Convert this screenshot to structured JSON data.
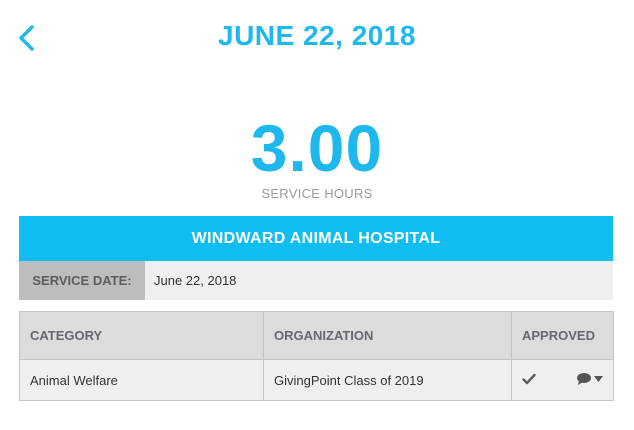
{
  "header": {
    "title": "JUNE 22, 2018",
    "back_icon": "chevron-left-icon"
  },
  "summary": {
    "hours": "3.00",
    "hours_label": "SERVICE HOURS"
  },
  "organization": {
    "name": "WINDWARD ANIMAL HOSPITAL"
  },
  "service_date": {
    "label": "SERVICE DATE:",
    "value": "June 22, 2018"
  },
  "table": {
    "headers": [
      "CATEGORY",
      "ORGANIZATION",
      "APPROVED"
    ],
    "rows": [
      {
        "category": "Animal Welfare",
        "organization": "GivingPoint Class of 2019",
        "approved_icon": "checkmark-icon",
        "action_icon": "comment-icon"
      }
    ]
  },
  "colors": {
    "accent": "#1fb8ec",
    "org_bar": "#10bdf0",
    "label_bg": "#bdbdbd",
    "row_bg": "#efefef",
    "header_bg": "#dcdcdc"
  }
}
